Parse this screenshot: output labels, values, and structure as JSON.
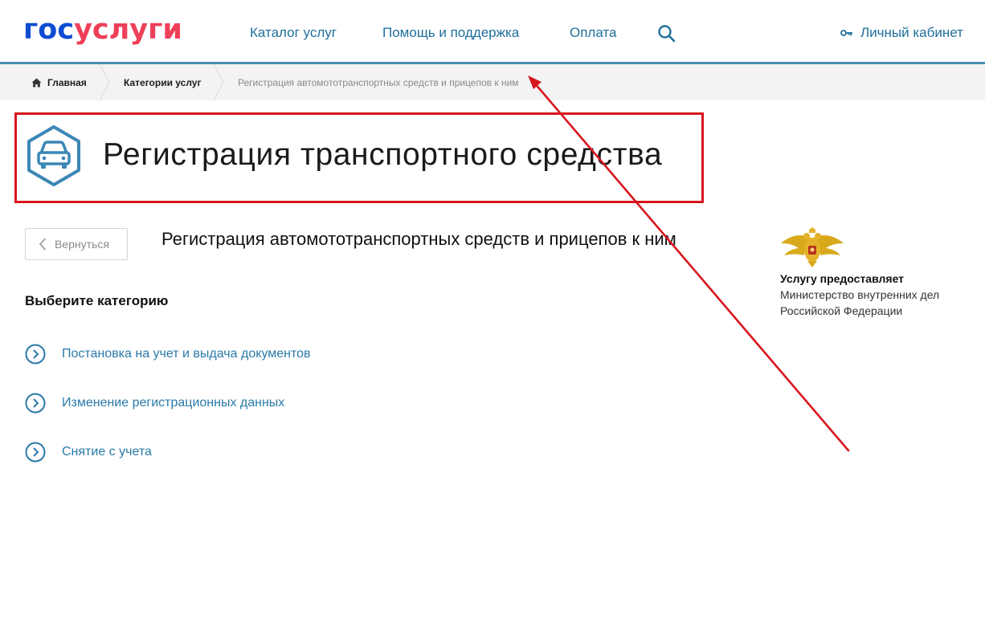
{
  "header": {
    "logo_part1": "гос",
    "logo_part2": "услуги",
    "nav": [
      {
        "label": "Каталог услуг"
      },
      {
        "label": "Помощь и поддержка"
      },
      {
        "label": "Оплата"
      }
    ],
    "search_icon": "search-icon",
    "cabinet_label": "Личный кабинет",
    "cabinet_icon": "key-icon"
  },
  "breadcrumb": {
    "home_icon": "home-icon",
    "items": [
      {
        "label": "Главная"
      },
      {
        "label": "Категории услуг"
      },
      {
        "label": "Регистрация автомототранспортных средств и прицепов к ним"
      }
    ]
  },
  "page": {
    "title": "Регистрация транспортного средства",
    "title_icon": "car-icon",
    "back_label": "Вернуться",
    "service_title": "Регистрация автомототранспортных средств и прицепов к ним",
    "choose_heading": "Выберите категорию",
    "categories": [
      {
        "label": "Постановка на учет и выдача документов"
      },
      {
        "label": "Изменение регистрационных данных"
      },
      {
        "label": "Снятие с учета"
      }
    ]
  },
  "provider": {
    "emblem_icon": "double-headed-eagle-emblem",
    "label": "Услугу предоставляет",
    "name": "Министерство внутренних дел Российской Федерации"
  },
  "colors": {
    "logo_blue": "#0d4cd3",
    "logo_red": "#ee3f58",
    "link": "#2a7aa8",
    "header_border": "#4a8db2",
    "annotation_red": "#d8161e"
  }
}
